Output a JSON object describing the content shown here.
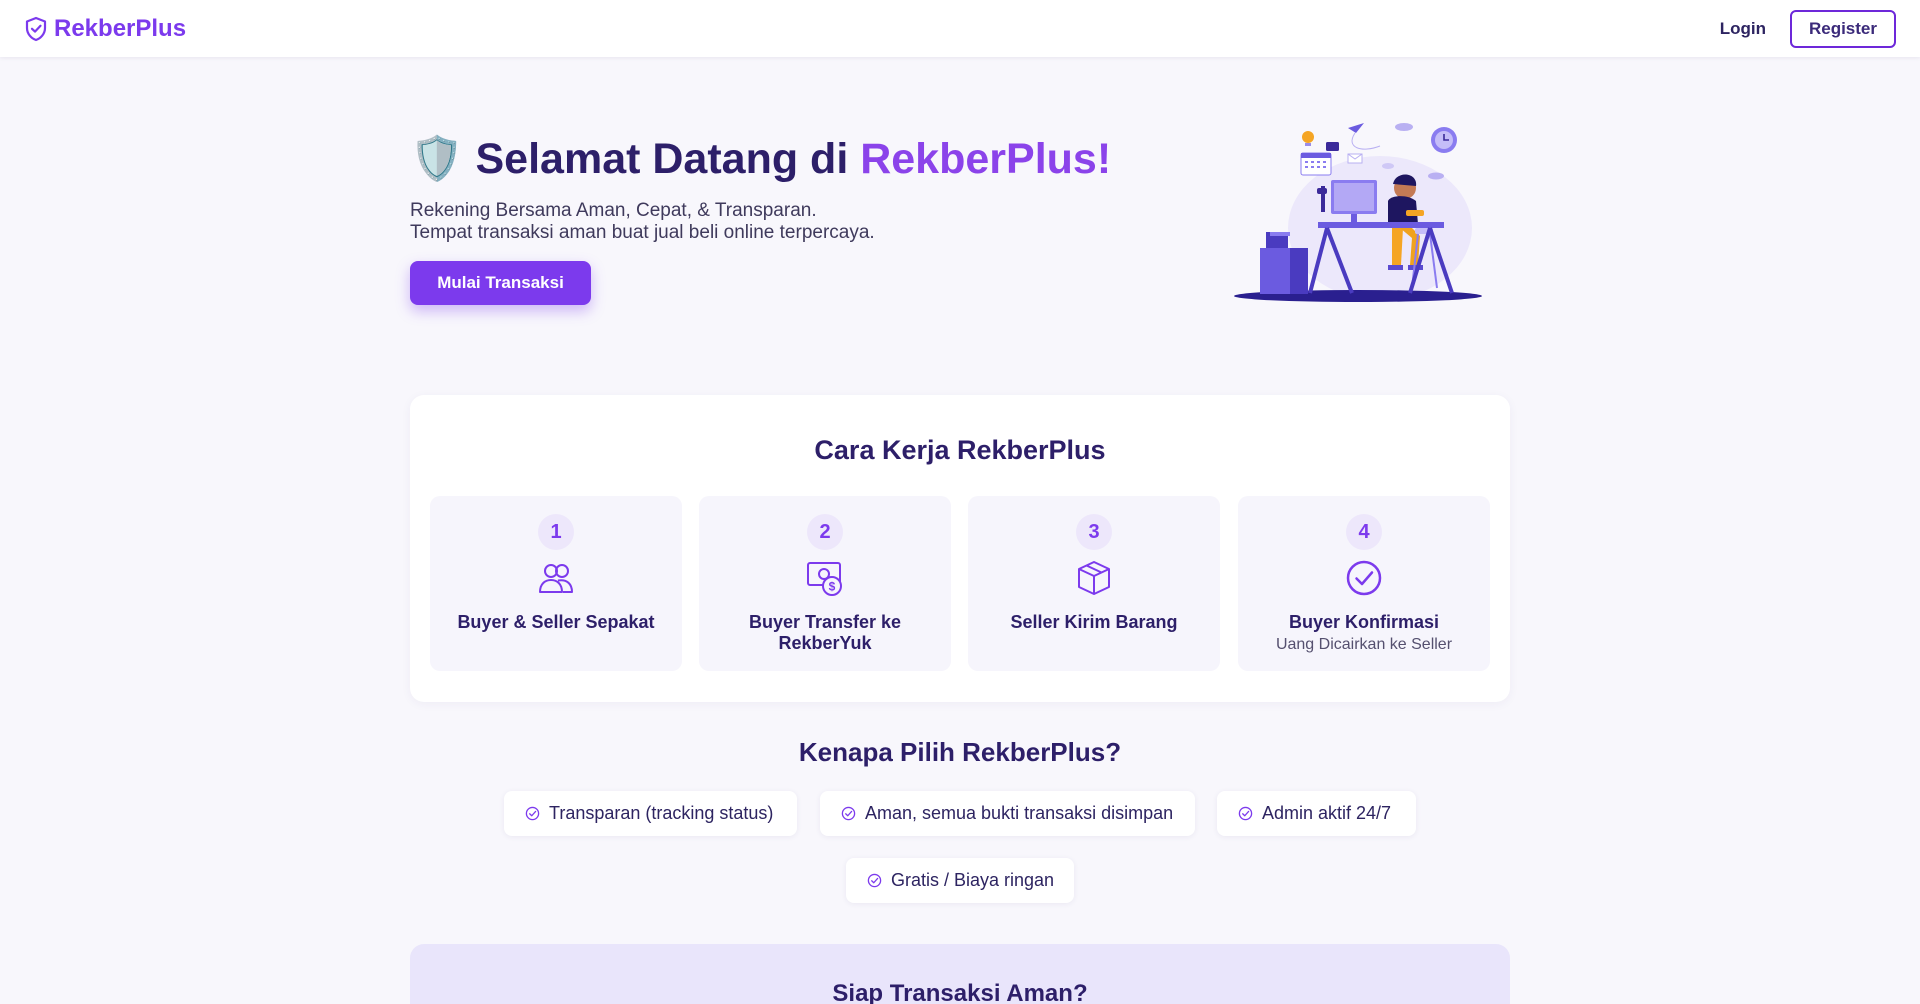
{
  "navbar": {
    "brand": "RekberPlus",
    "login": "Login",
    "register": "Register"
  },
  "hero": {
    "emoji": "🛡️",
    "title_prefix": "Selamat Datang di",
    "title_accent": "RekberPlus!",
    "subtitle_line1": "Rekening Bersama Aman, Cepat, & Transparan.",
    "subtitle_line2": "Tempat transaksi aman buat jual beli online terpercaya.",
    "cta": "Mulai Transaksi"
  },
  "how": {
    "title": "Cara Kerja RekberPlus",
    "steps": [
      {
        "number": "1",
        "title": "Buyer & Seller Sepakat",
        "note": "",
        "icon": "users-icon"
      },
      {
        "number": "2",
        "title": "Buyer Transfer ke RekberYuk",
        "note": "",
        "icon": "money-transfer-icon"
      },
      {
        "number": "3",
        "title": "Seller Kirim Barang",
        "note": "",
        "icon": "box-icon"
      },
      {
        "number": "4",
        "title": "Buyer Konfirmasi",
        "note": "Uang Dicairkan ke Seller",
        "icon": "check-circle-icon"
      }
    ]
  },
  "why": {
    "title": "Kenapa Pilih RekberPlus?",
    "items": [
      "Transparan (tracking status)",
      "Aman, semua bukti transaksi disimpan",
      "Admin aktif 24/7",
      "Gratis / Biaya ringan"
    ]
  },
  "cta_section": {
    "title": "Siap Transaksi Aman?"
  },
  "colors": {
    "accent": "#7c3aed",
    "heading": "#2d1f69",
    "background": "#f8f7fc"
  }
}
